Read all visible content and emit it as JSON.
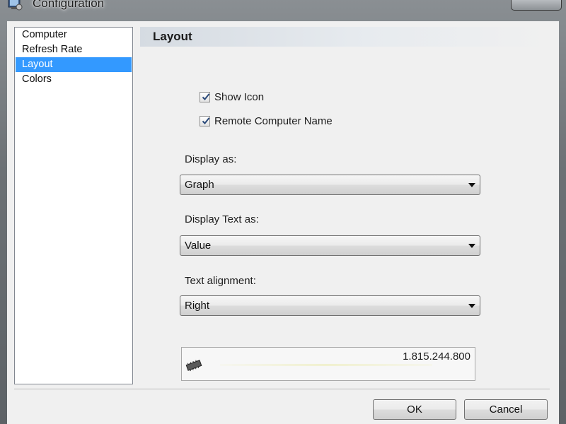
{
  "window": {
    "title": "Configuration",
    "app_icon": "configuration-app-icon",
    "close_icon": "close-icon"
  },
  "sidebar": {
    "items": [
      {
        "label": "Computer",
        "selected": false
      },
      {
        "label": "Refresh Rate",
        "selected": false
      },
      {
        "label": "Layout",
        "selected": true
      },
      {
        "label": "Colors",
        "selected": false
      }
    ]
  },
  "section": {
    "title": "Layout"
  },
  "options": {
    "show_icon": {
      "label": "Show Icon",
      "checked": true
    },
    "remote_computer_name": {
      "label": "Remote Computer Name",
      "checked": true
    }
  },
  "fields": {
    "display_as": {
      "label": "Display as:",
      "value": "Graph"
    },
    "display_text_as": {
      "label": "Display Text as:",
      "value": "Value"
    },
    "text_alignment": {
      "label": "Text alignment:",
      "value": "Right"
    }
  },
  "preview": {
    "value": "1.815.244.800",
    "icon": "memory-chip-icon"
  },
  "buttons": {
    "ok": "OK",
    "cancel": "Cancel"
  },
  "colors": {
    "selection": "#3399ff",
    "dialog_bg": "#f0f0f0"
  }
}
